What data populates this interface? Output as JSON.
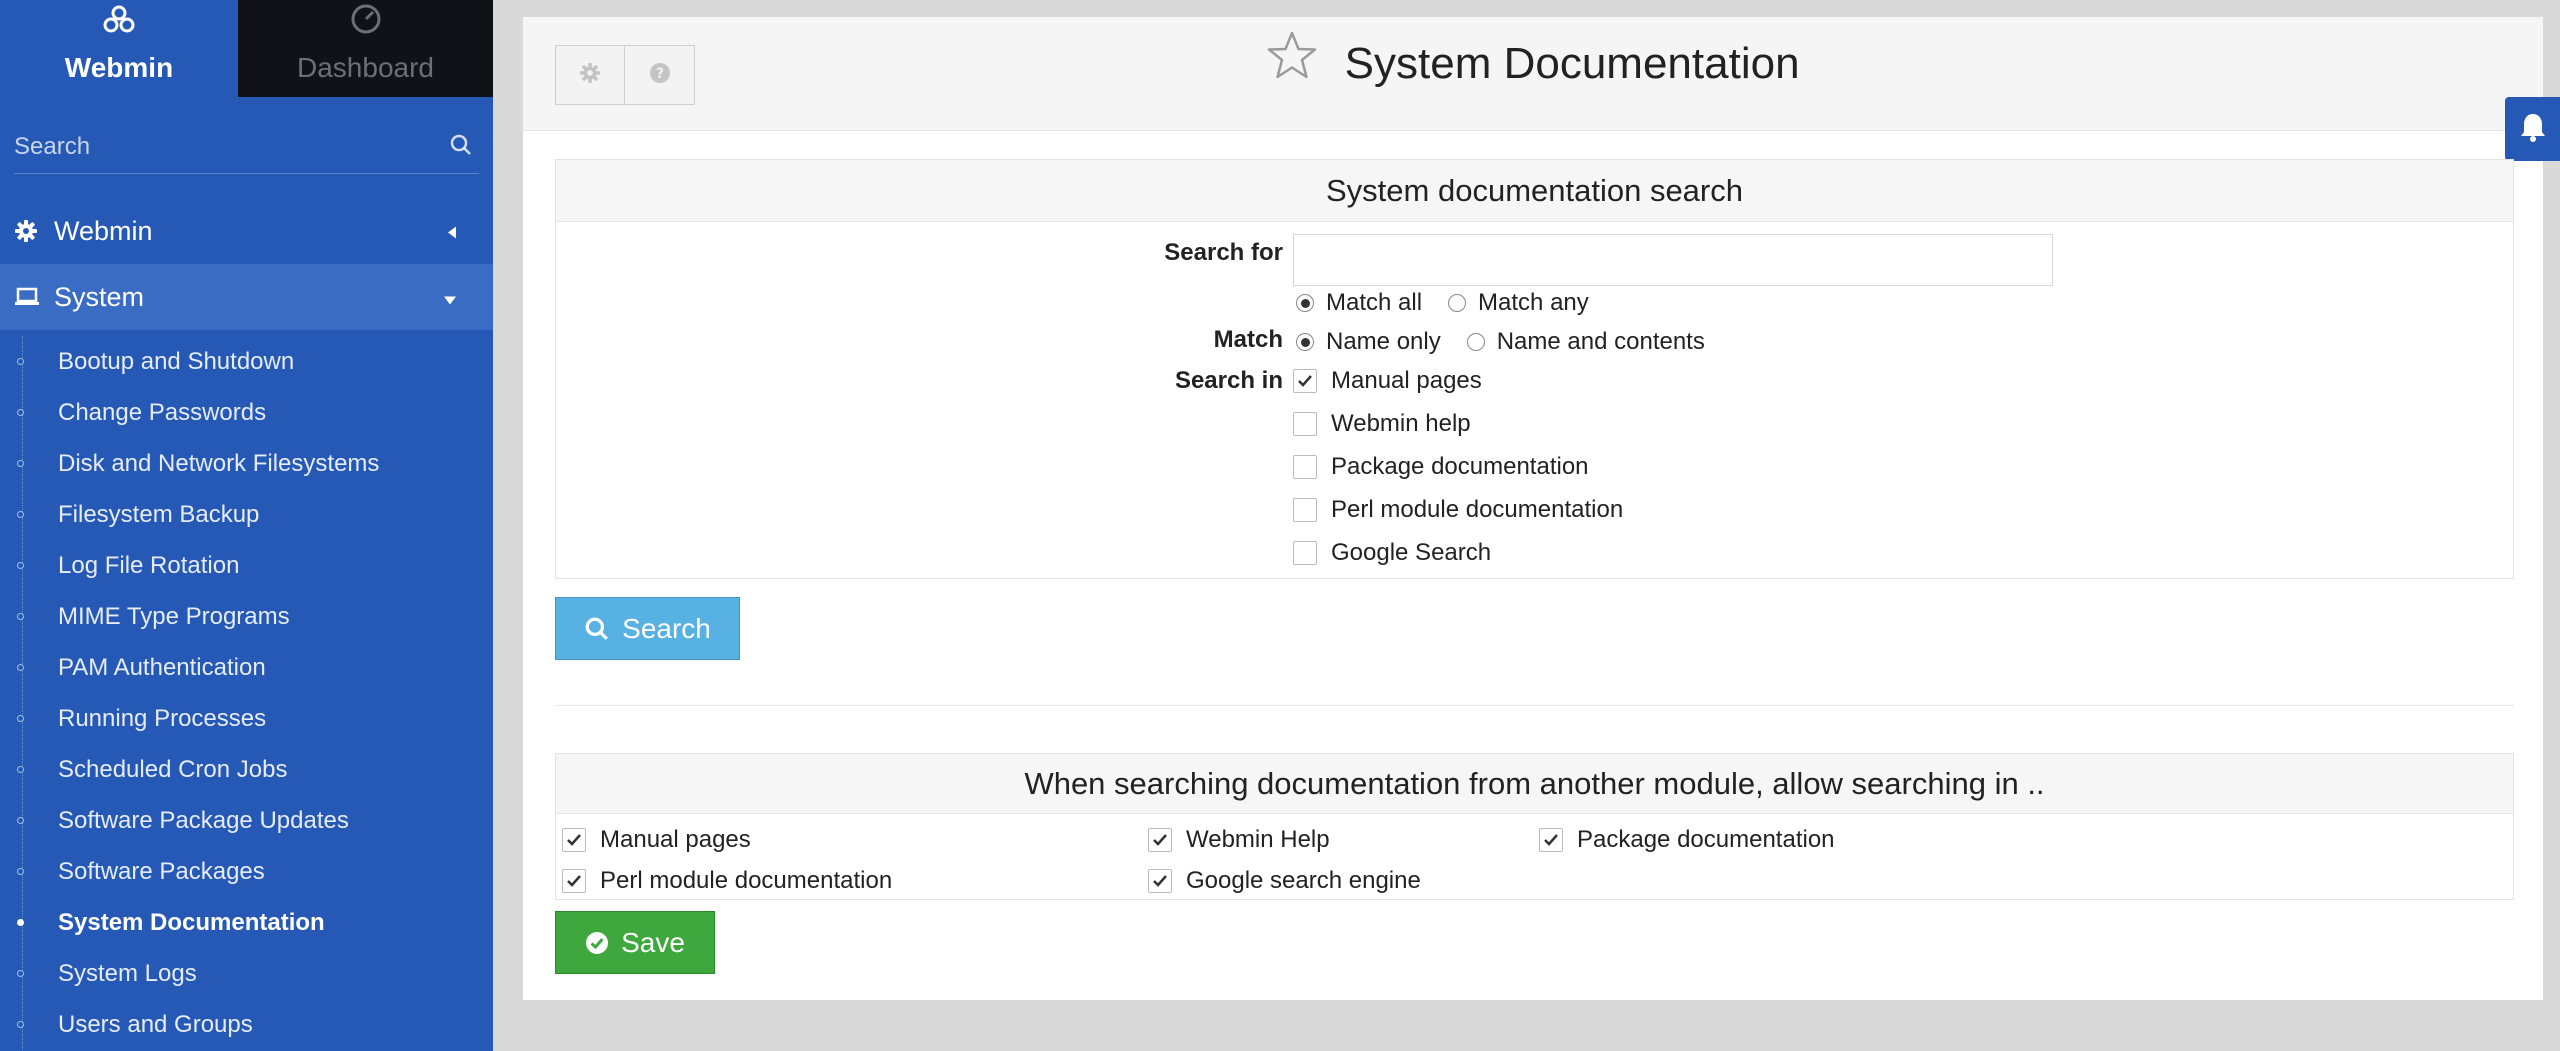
{
  "sidebar": {
    "tabs": {
      "webmin": "Webmin",
      "dashboard": "Dashboard"
    },
    "search_placeholder": "Search",
    "sections": [
      {
        "label": "Webmin",
        "icon": "gear-icon"
      },
      {
        "label": "System",
        "icon": "laptop-icon"
      }
    ],
    "items": [
      "Bootup and Shutdown",
      "Change Passwords",
      "Disk and Network Filesystems",
      "Filesystem Backup",
      "Log File Rotation",
      "MIME Type Programs",
      "PAM Authentication",
      "Running Processes",
      "Scheduled Cron Jobs",
      "Software Package Updates",
      "Software Packages",
      "System Documentation",
      "System Logs",
      "Users and Groups"
    ],
    "active_item": "System Documentation"
  },
  "header": {
    "title": "System Documentation",
    "buttons": [
      "gear-icon",
      "question-icon"
    ]
  },
  "search_panel": {
    "title": "System documentation search",
    "search_for_label": "Search for",
    "search_for_value": "",
    "match_mode": {
      "options": [
        "Match all",
        "Match any"
      ],
      "selected": "Match all"
    },
    "match_label": "Match",
    "match_scope": {
      "options": [
        "Name only",
        "Name and contents"
      ],
      "selected": "Name only"
    },
    "search_in_label": "Search in",
    "search_in": [
      {
        "label": "Manual pages",
        "checked": true
      },
      {
        "label": "Webmin help",
        "checked": false
      },
      {
        "label": "Package documentation",
        "checked": false
      },
      {
        "label": "Perl module documentation",
        "checked": false
      },
      {
        "label": "Google Search",
        "checked": false
      }
    ],
    "search_button": "Search"
  },
  "module_panel": {
    "title": "When searching documentation from another module, allow searching in ..",
    "options": [
      {
        "label": "Manual pages",
        "checked": true
      },
      {
        "label": "Webmin Help",
        "checked": true
      },
      {
        "label": "Package documentation",
        "checked": true
      },
      {
        "label": "Perl module documentation",
        "checked": true
      },
      {
        "label": "Google search engine",
        "checked": true
      }
    ],
    "save_button": "Save"
  },
  "colors": {
    "sidebar": "#2559b5",
    "dashboard_tab": "#111217",
    "search_button": "#58b1e3",
    "save_button": "#3ea83e"
  }
}
